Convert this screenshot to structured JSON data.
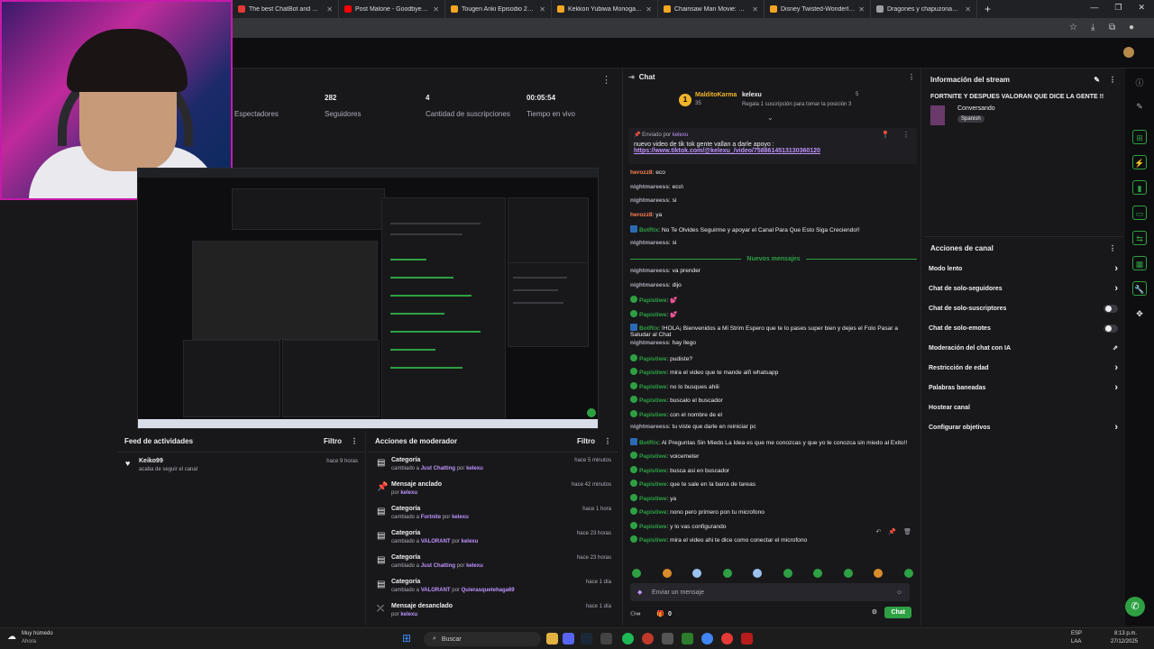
{
  "browser": {
    "tabs": [
      {
        "title": "The best ChatBot and Widgets",
        "color": "#e53935"
      },
      {
        "title": "Post Malone - Goodbyes ft. Yo",
        "color": "#ff0000"
      },
      {
        "title": "Tougen Anki Episodio 24 Sub E",
        "color": "#f5a623"
      },
      {
        "title": "Kekkon Yubiwa Monogatari II E",
        "color": "#f5a623"
      },
      {
        "title": "Chainsaw Man Movie: Reze-he",
        "color": "#f5a623"
      },
      {
        "title": "Disney Twisted-Wonderland Th",
        "color": "#f5a623"
      },
      {
        "title": "Dragones y chapuzonas | Wiki",
        "color": "#9aa0a6"
      }
    ]
  },
  "stats": {
    "s1_label": "Espectadores",
    "followers_value": "282",
    "followers_label": "Seguidores",
    "subs_value": "4",
    "subs_label": "Cantidad de suscripciones",
    "live_value": "00:05:54",
    "live_label": "Tiempo en vivo"
  },
  "feed": {
    "title": "Feed de actividades",
    "filter": "Filtro",
    "items": [
      {
        "name": "Keiko99",
        "sub": "acaba de seguir el canal",
        "time": "hace 9 horas"
      }
    ]
  },
  "mod": {
    "title": "Acciones de moderador",
    "filter": "Filtro",
    "items": [
      {
        "title": "Categoría",
        "pre": "cambiado a",
        "target": "Just Chatting",
        "by": "por",
        "who": "kelexu",
        "time": "hace 5 minutos"
      },
      {
        "title": "Mensaje anclado",
        "pre": "",
        "target": "",
        "by": "por",
        "who": "kelexu",
        "time": "hace 42 minutos"
      },
      {
        "title": "Categoría",
        "pre": "cambiado a",
        "target": "Fortnite",
        "by": "por",
        "who": "kelexu",
        "time": "hace 1 hora"
      },
      {
        "title": "Categoría",
        "pre": "cambiado a",
        "target": "VALORANT",
        "by": "por",
        "who": "kelexu",
        "time": "hace 23 horas"
      },
      {
        "title": "Categoría",
        "pre": "cambiado a",
        "target": "Just Chatting",
        "by": "por",
        "who": "kelexu",
        "time": "hace 23 horas"
      },
      {
        "title": "Categoría",
        "pre": "cambiado a",
        "target": "VALORANT",
        "by": "por",
        "who": "Quierasquetehaga69",
        "time": "hace 1 día"
      },
      {
        "title": "Mensaje desanclado",
        "pre": "",
        "target": "",
        "by": "por",
        "who": "kelexu",
        "time": "hace 1 día"
      }
    ]
  },
  "chat": {
    "title": "Chat",
    "leader1_name": "MalditoKarma",
    "leader1_count": "35",
    "leader2_name": "kelexu",
    "leader2_count": "5",
    "leader_sub": "Regala 1 suscripción para tomar la posición 3",
    "pinned_by_label": "Enviado por",
    "pinned_by": "kelexu",
    "pinned_text": "nuevo video de tik tok gente vallan a darle apoyo :",
    "pinned_url": "https://www.tiktok.com/@kelexu_/video/7588614513130360120",
    "new_messages": "Nuevos mensajes",
    "messages_before": [
      {
        "user": "herozz8",
        "text": "eco",
        "color": "#ff7f50",
        "badge": ""
      },
      {
        "user": "nightmareess",
        "text": "eco\\",
        "color": "#adadb8",
        "badge": ""
      },
      {
        "user": "nightmareess",
        "text": "si",
        "color": "#adadb8",
        "badge": ""
      },
      {
        "user": "herozz8",
        "text": "ya",
        "color": "#ff7f50",
        "badge": ""
      },
      {
        "user": "BotRix",
        "text": "No Te Olvides Seguirme y apoyar el Canal Para Que Esto Siga Creciendo!!",
        "color": "#2ea043",
        "badge": "bot"
      },
      {
        "user": "nightmareess",
        "text": "si",
        "color": "#adadb8",
        "badge": ""
      }
    ],
    "messages_after": [
      {
        "user": "nightmareess",
        "text": "va prender",
        "color": "#adadb8",
        "badge": ""
      },
      {
        "user": "nightmareess",
        "text": "dijo",
        "color": "#adadb8",
        "badge": ""
      },
      {
        "user": "Papistiwe",
        "text": "💕",
        "color": "#2ea043",
        "badge": "g"
      },
      {
        "user": "Papistiwe",
        "text": "💕",
        "color": "#2ea043",
        "badge": "g"
      },
      {
        "user": "BotRix",
        "text": "!HOLA¡ Bienvenidos a Mi Strim Espero que te lo pases super bien y dejes el Folo Pasar a Saludar al Chat",
        "color": "#2ea043",
        "badge": "bot"
      },
      {
        "user": "nightmareess",
        "text": "hay llego",
        "color": "#adadb8",
        "badge": ""
      },
      {
        "user": "Papistiwe",
        "text": "pudiste?",
        "color": "#2ea043",
        "badge": "g"
      },
      {
        "user": "Papistiwe",
        "text": "mira el video que te mande alñ whatsapp",
        "color": "#2ea043",
        "badge": "g"
      },
      {
        "user": "Papistiwe",
        "text": "no lo busques ahiii",
        "color": "#2ea043",
        "badge": "g"
      },
      {
        "user": "Papistiwe",
        "text": "buscalo el buscador",
        "color": "#2ea043",
        "badge": "g"
      },
      {
        "user": "Papistiwe",
        "text": "con el nombre de el",
        "color": "#2ea043",
        "badge": "g"
      },
      {
        "user": "nightmareess",
        "text": "tu viste que darle en reiniciar pc",
        "color": "#adadb8",
        "badge": ""
      },
      {
        "user": "BotRix",
        "text": "Al Preguntas Sin Miedo La Idea es que me conozcas y que yo te conozca sin miedo al Exito!!",
        "color": "#2ea043",
        "badge": "bot"
      },
      {
        "user": "Papistiwe",
        "text": "voicemeter",
        "color": "#2ea043",
        "badge": "g"
      },
      {
        "user": "Papistiwe",
        "text": "busca asi en buscador",
        "color": "#2ea043",
        "badge": "g"
      },
      {
        "user": "Papistiwe",
        "text": "que te sale en la barra de tareas",
        "color": "#2ea043",
        "badge": "g"
      },
      {
        "user": "Papistiwe",
        "text": "ya",
        "color": "#2ea043",
        "badge": "g"
      },
      {
        "user": "Papistiwe",
        "text": "nono pero primero pon tu microfono",
        "color": "#2ea043",
        "badge": "g"
      },
      {
        "user": "Papistiwe",
        "text": "y lo vas configurando",
        "color": "#2ea043",
        "badge": "g"
      },
      {
        "user": "Papistiwe",
        "text": "mira el video ahi te dice como conectar el microfono",
        "color": "#2ea043",
        "badge": "g"
      }
    ],
    "input_placeholder": "Enviar un mensaje",
    "points": "0",
    "send_label": "Chat"
  },
  "info": {
    "title": "Información del stream",
    "stream_title": "FORTNITE Y DESPUES VALORAN QUE DICE LA GENTE !!",
    "category": "Conversando",
    "tag": "Spanish"
  },
  "channel_actions": {
    "title": "Acciones de canal",
    "items": [
      {
        "label": "Modo lento",
        "ctrl": "arrow"
      },
      {
        "label": "Chat de solo-seguidores",
        "ctrl": "arrow"
      },
      {
        "label": "Chat de solo-suscriptores",
        "ctrl": "toggle"
      },
      {
        "label": "Chat de solo-emotes",
        "ctrl": "toggle"
      },
      {
        "label": "Moderación del chat con IA",
        "ctrl": "ext"
      },
      {
        "label": "Restricción de edad",
        "ctrl": "arrow"
      },
      {
        "label": "Palabras baneadas",
        "ctrl": "arrow"
      },
      {
        "label": "Hostear canal",
        "ctrl": ""
      },
      {
        "label": "Configurar objetivos",
        "ctrl": "arrow"
      }
    ]
  },
  "taskbar": {
    "weather": "Muy húmedo",
    "weather_sub": "Ahora",
    "search": "Buscar",
    "lang": "ESP",
    "lang2": "LAA",
    "time": "8:13 p.m.",
    "date": "27/12/2025"
  }
}
